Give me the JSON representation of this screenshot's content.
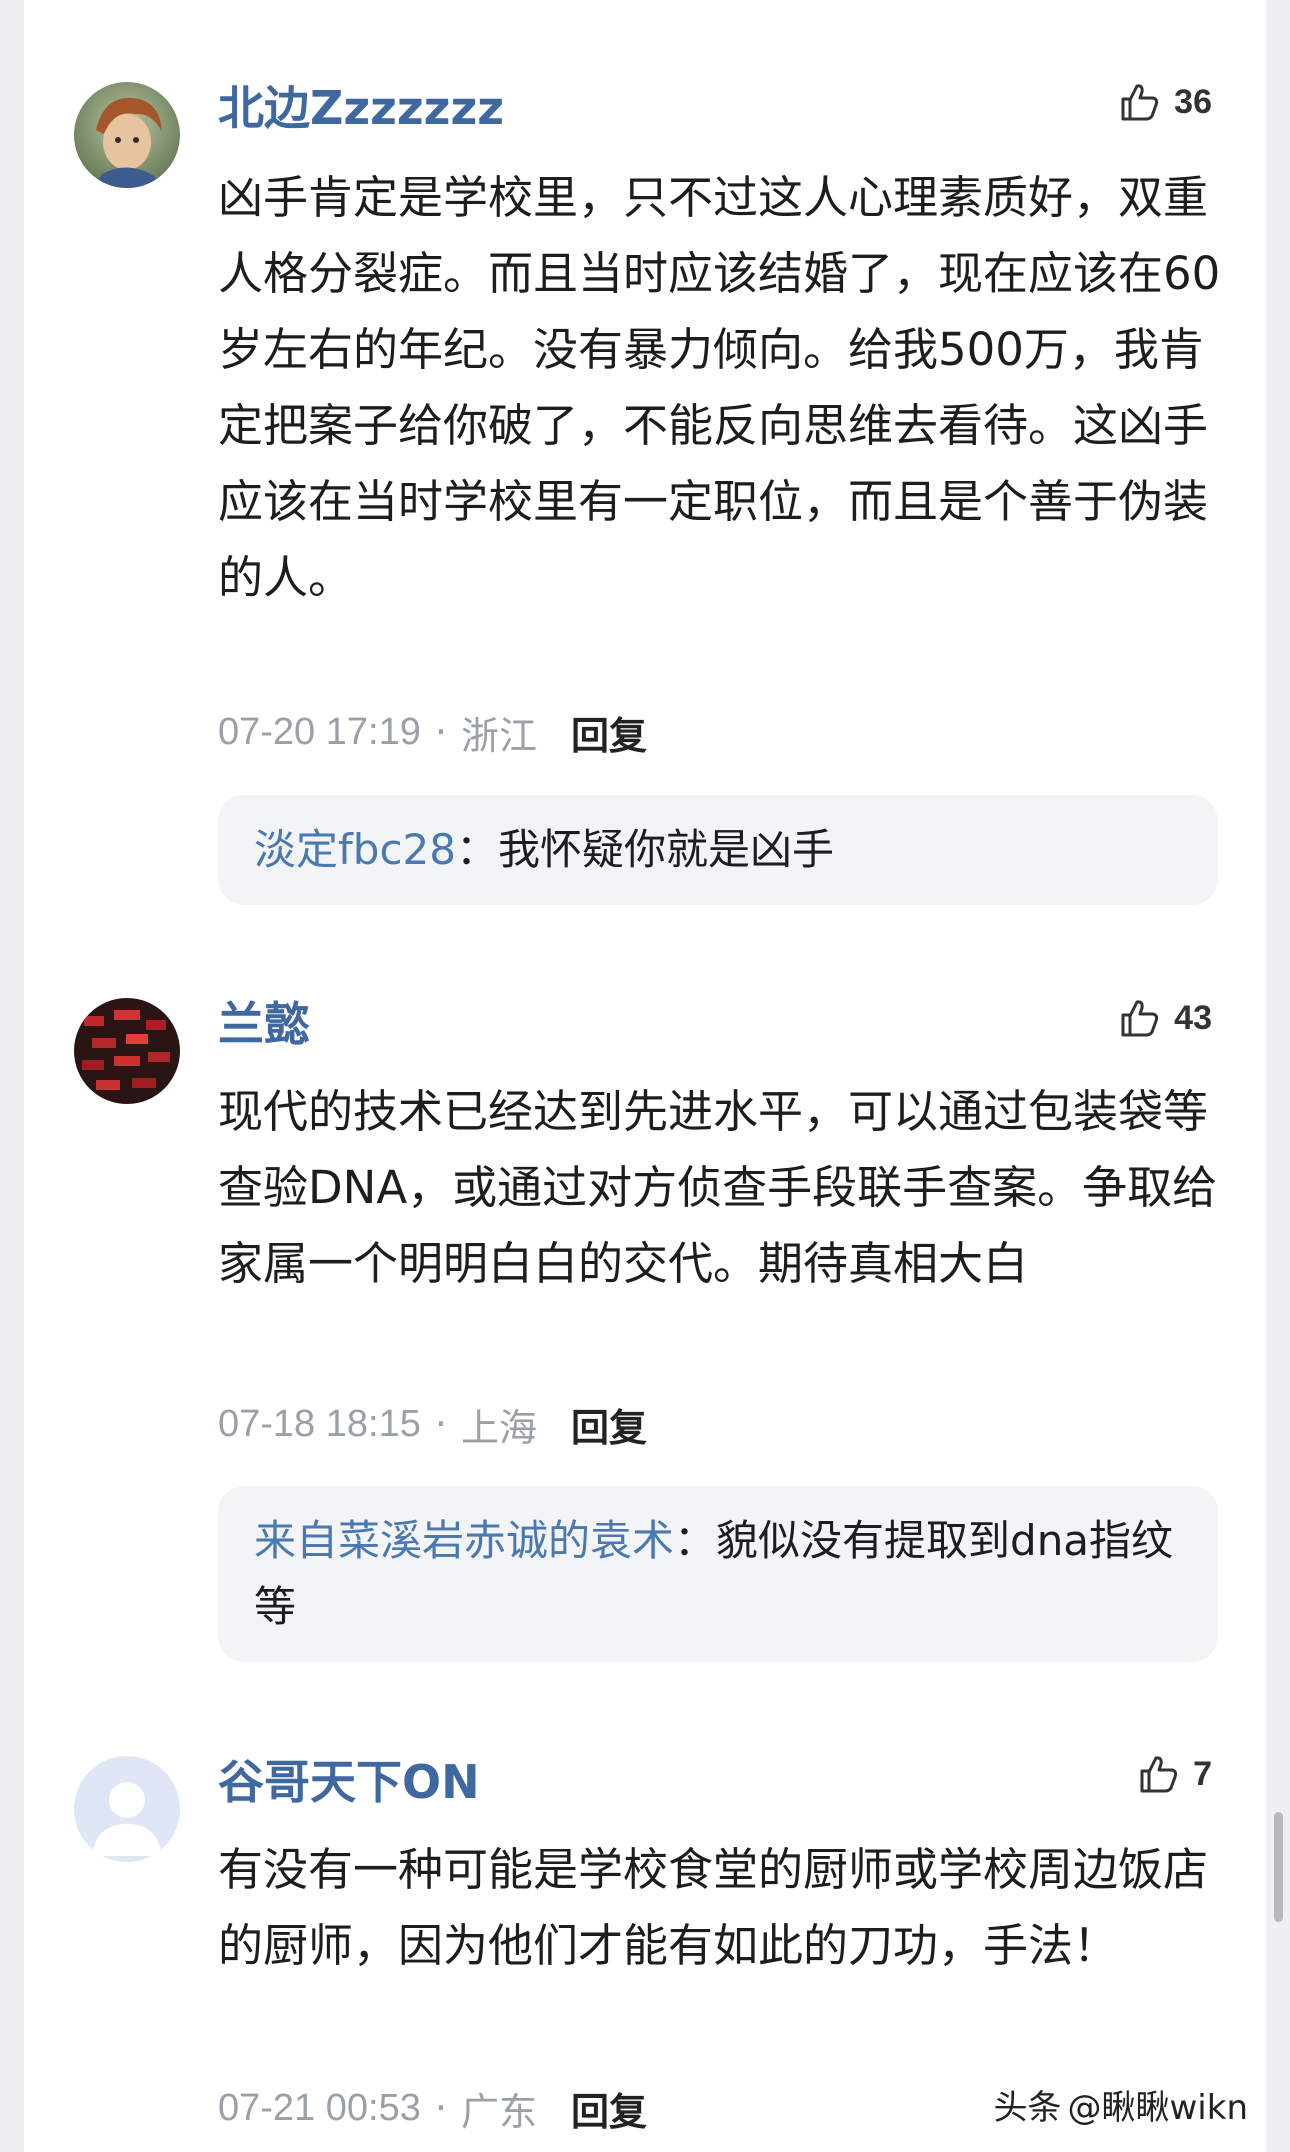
{
  "comments": [
    {
      "username": "北边Zzzzzzz",
      "likes": "36",
      "text": "凶手肯定是学校里，只不过这人心理素质好，双重人格分裂症。而且当时应该结婚了，现在应该在60岁左右的年纪。没有暴力倾向。给我500万，我肯定把案子给你破了，不能反向思维去看待。这凶手应该在当时学校里有一定职位，而且是个善于伪装的人。",
      "time": "07-20 17:19",
      "separator": "·",
      "location": "浙江",
      "reply_label": "回复",
      "reply": {
        "name": "淡定fbc28",
        "colon": "：",
        "text": "我怀疑你就是凶手"
      }
    },
    {
      "username": "兰懿",
      "likes": "43",
      "text": "现代的技术已经达到先进水平，可以通过包装袋等查验DNA，或通过对方侦查手段联手查案。争取给家属一个明明白白的交代。期待真相大白",
      "time": "07-18 18:15",
      "separator": "·",
      "location": "上海",
      "reply_label": "回复",
      "reply": {
        "name": "来自菜溪岩赤诚的袁术",
        "colon": "：",
        "text": "貌似没有提取到dna指纹等"
      }
    },
    {
      "username": "谷哥天下ON",
      "likes": "7",
      "text": "有没有一种可能是学校食堂的厨师或学校周边饭店的厨师，因为他们才能有如此的刀功，手法！",
      "time": "07-21 00:53",
      "separator": "·",
      "location": "广东",
      "reply_label": "回复"
    }
  ],
  "icons": {
    "like": "thumbs-up-icon"
  },
  "watermark": {
    "prefix": "头条",
    "handle": "@瞅瞅wikn"
  },
  "colors": {
    "username": "#3f67a0",
    "reply_name": "#4a78b0",
    "meta": "#9aa0a6",
    "reply_bg": "#f3f4f6"
  }
}
